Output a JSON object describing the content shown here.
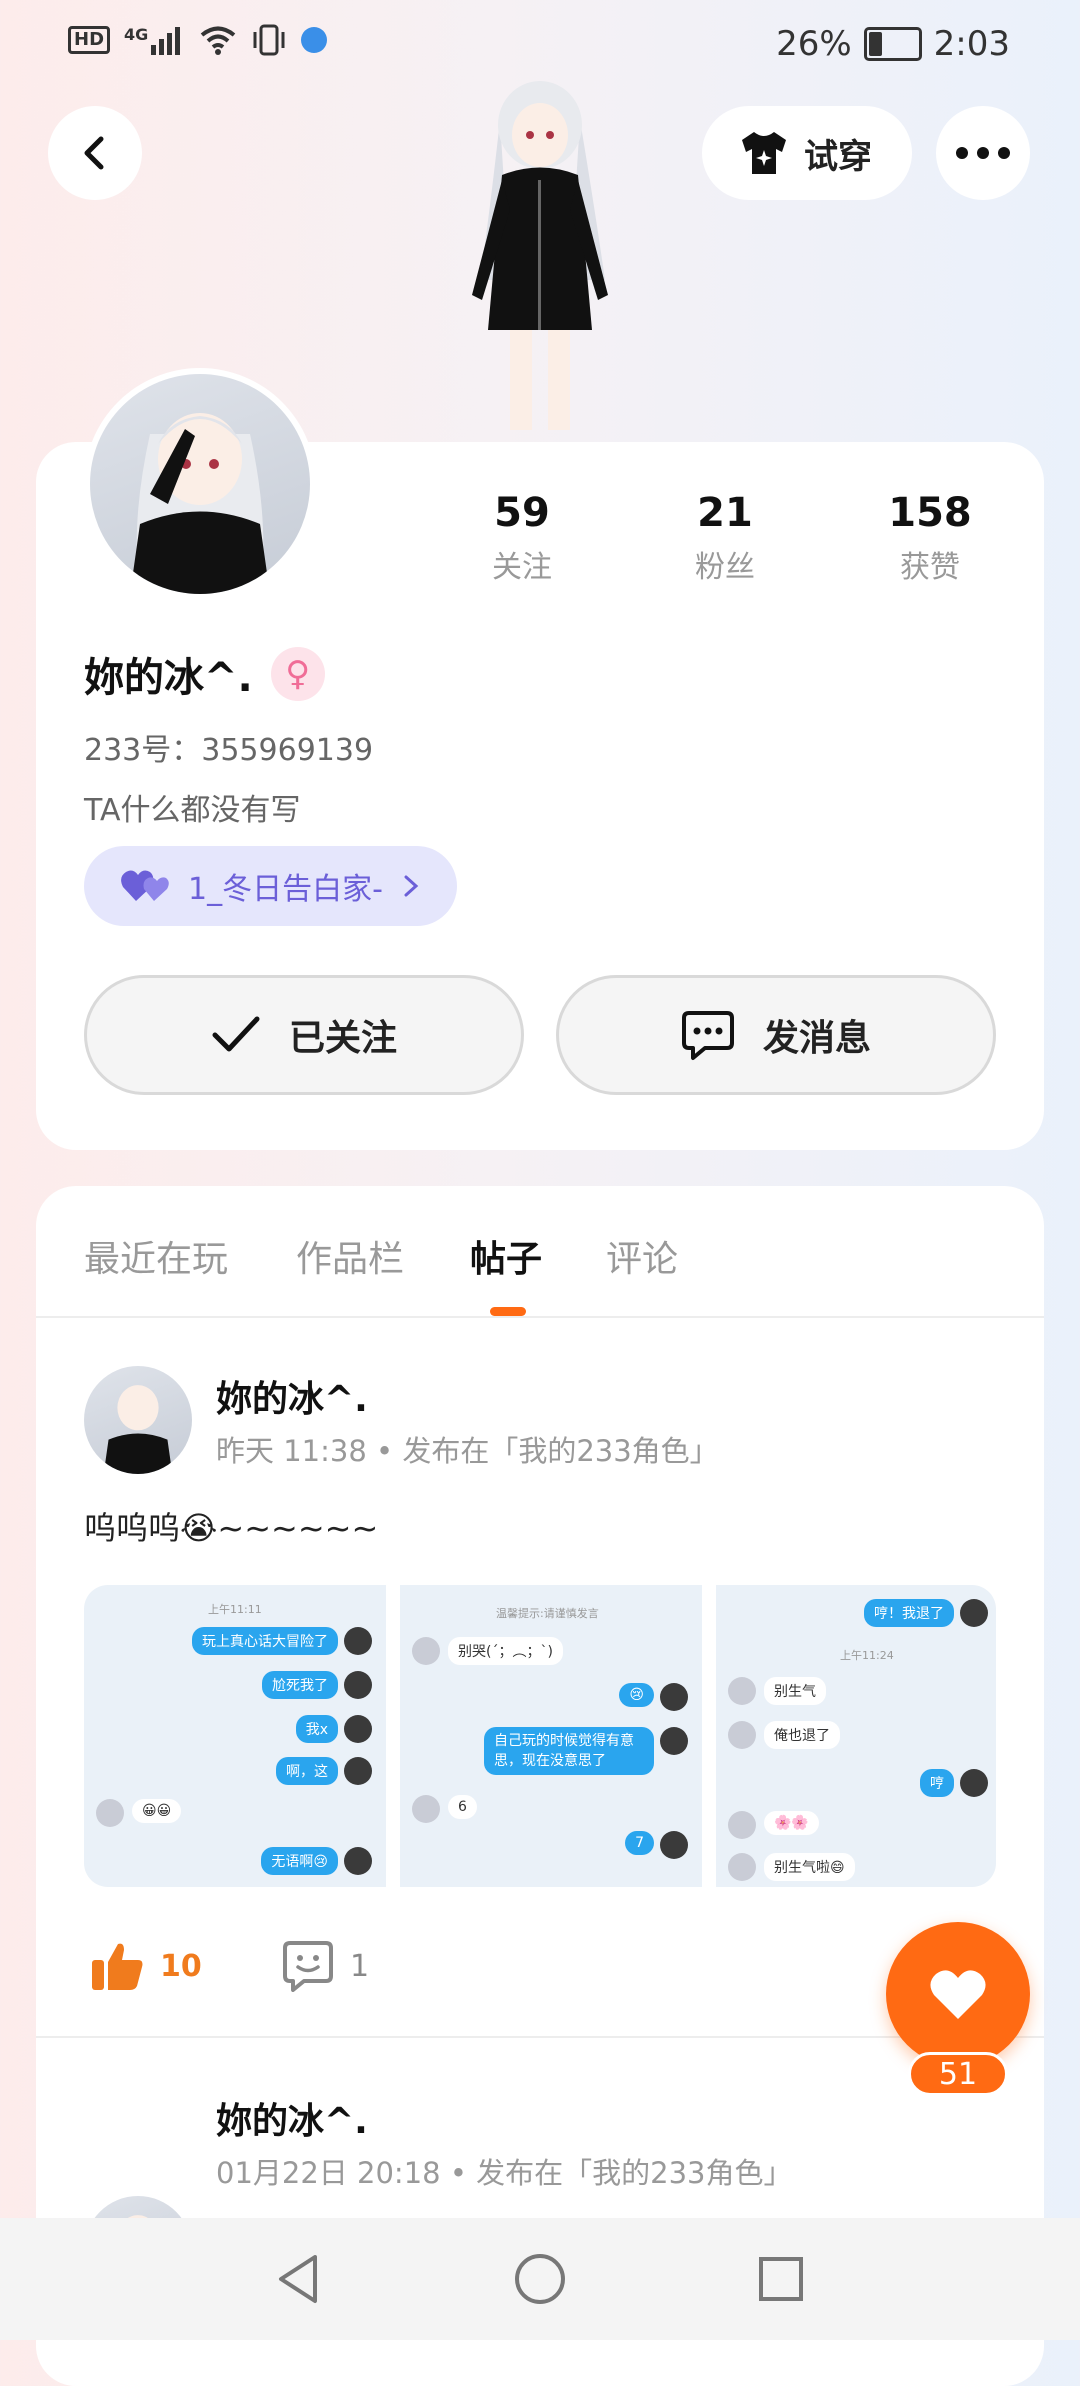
{
  "status_bar": {
    "hd": "HD",
    "network": "4G",
    "battery_percent": "26%",
    "battery_level": 0.26,
    "time": "2:03"
  },
  "header": {
    "back_icon": "back-arrow-icon",
    "try_on_label": "试穿",
    "try_on_icon": "tshirt-icon",
    "more_icon": "more-dots-icon"
  },
  "profile": {
    "stats": [
      {
        "value": "59",
        "label": "关注"
      },
      {
        "value": "21",
        "label": "粉丝"
      },
      {
        "value": "158",
        "label": "获赞"
      }
    ],
    "name": "妳的冰^.",
    "gender_icon": "female-icon",
    "id_line": "233号：355969139",
    "bio": "TA什么都没有写",
    "tag": {
      "label": "1_冬日告白家-",
      "icon": "heart-pair-icon"
    },
    "follow_label": "已关注",
    "message_label": "发消息"
  },
  "tabs": [
    {
      "label": "最近在玩",
      "active": false
    },
    {
      "label": "作品栏",
      "active": false
    },
    {
      "label": "帖子",
      "active": true
    },
    {
      "label": "评论",
      "active": false
    }
  ],
  "posts": [
    {
      "author": "妳的冰^.",
      "meta": "昨天 11:38 • 发布在「我的233角色」",
      "text": "呜呜呜😭~~~~~~",
      "likes": "10",
      "comments": "1"
    },
    {
      "author": "妳的冰^.",
      "meta": "01月22日 20:18 • 发布在「我的233角色」"
    }
  ],
  "screenshot_texts": {
    "shot1": {
      "time": "上午11:11",
      "lines": [
        "玩上真心话大冒险了",
        "尬死我了",
        "我x",
        "啊，这",
        "😀😀",
        "无语啊😢"
      ]
    },
    "shot2": {
      "notice": "温馨提示:请谨慎发言",
      "lines": [
        "别哭(´；︵；`)",
        "😢",
        "自己玩的时候觉得有意思，现在没意思了",
        "6",
        "7"
      ]
    },
    "shot3": {
      "time": "上午11:24",
      "lines": [
        "哼！我退了",
        "别生气",
        "俺也退了",
        "哼",
        "🌸🌸",
        "别生气啦😄"
      ]
    }
  },
  "fab": {
    "icon": "heart-icon",
    "count": "51"
  },
  "nav": {
    "back": "nav-back-icon",
    "home": "nav-home-icon",
    "recent": "nav-recent-icon"
  }
}
